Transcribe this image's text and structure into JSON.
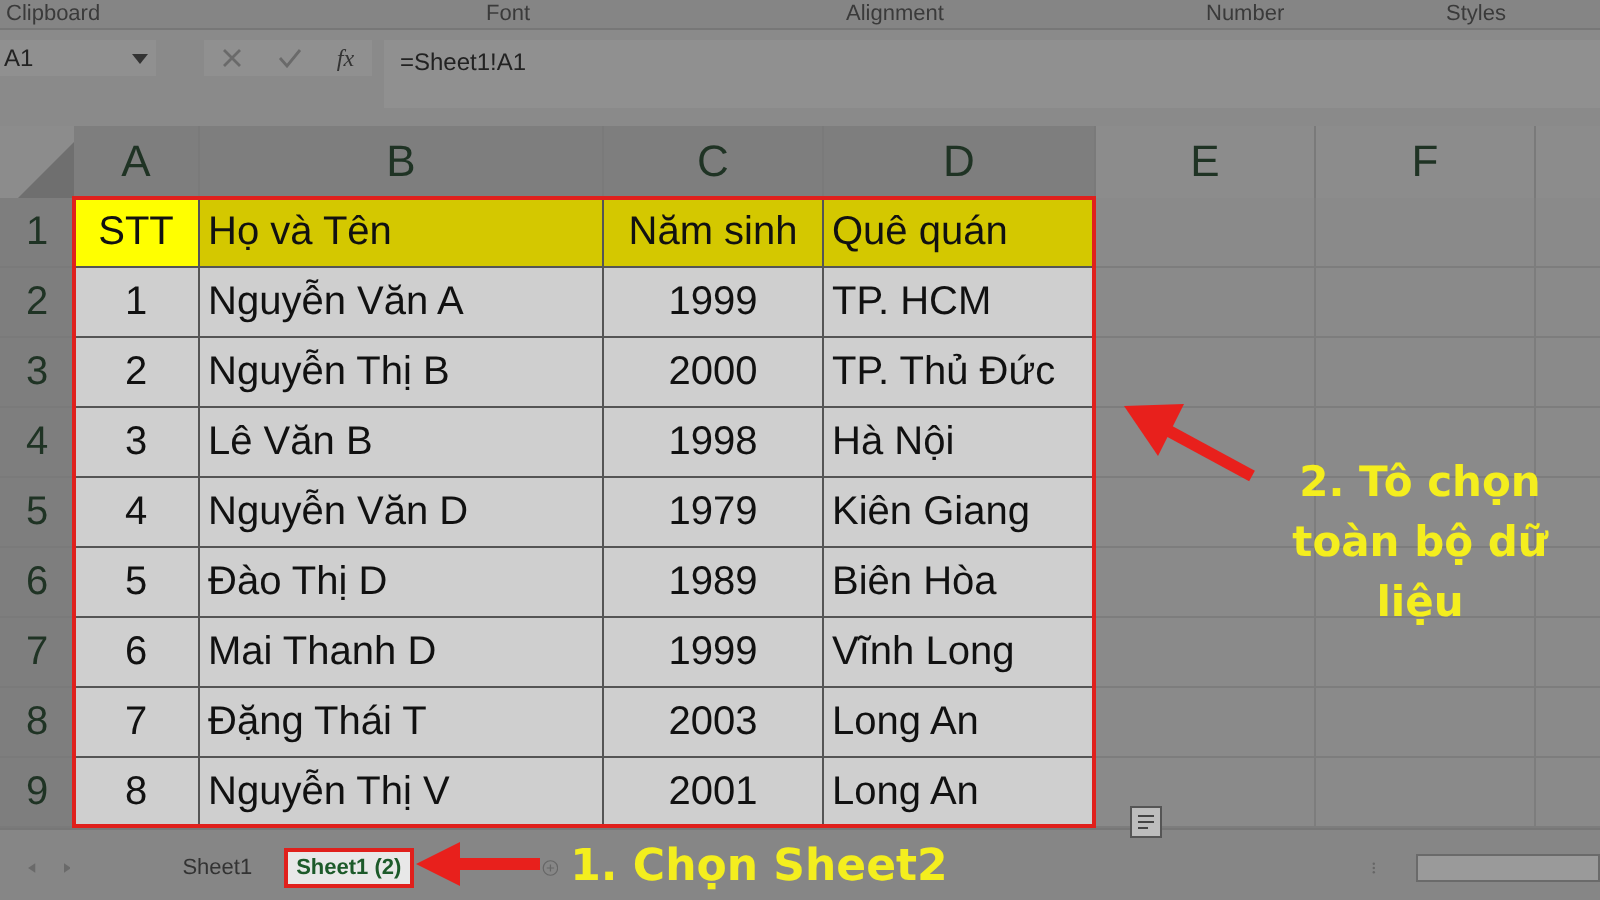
{
  "ribbon_groups": [
    "Clipboard",
    "Font",
    "Alignment",
    "Number",
    "Styles"
  ],
  "formula_bar": {
    "name_box": "A1",
    "fx": "fx",
    "formula": "=Sheet1!A1"
  },
  "columns": [
    "A",
    "B",
    "C",
    "D",
    "E",
    "F"
  ],
  "header_row": {
    "number": "1",
    "cells": [
      {
        "text": "STT",
        "color": "#ffff00"
      },
      {
        "text": "Họ và Tên",
        "color": "#d4c800"
      },
      {
        "text": "Năm sinh",
        "color": "#d4c800"
      },
      {
        "text": "Quê quán",
        "color": "#d4c800"
      }
    ]
  },
  "rows": [
    {
      "number": "2",
      "selected": true,
      "cells": [
        "1",
        "Nguyễn Văn A",
        "1999",
        "TP. HCM"
      ]
    },
    {
      "number": "3",
      "selected": true,
      "cells": [
        "2",
        "Nguyễn Thị B",
        "2000",
        "TP. Thủ Đức"
      ]
    },
    {
      "number": "4",
      "selected": true,
      "cells": [
        "3",
        "Lê Văn B",
        "1998",
        "Hà Nội"
      ]
    },
    {
      "number": "5",
      "selected": true,
      "cells": [
        "4",
        "Nguyễn Văn D",
        "1979",
        "Kiên Giang"
      ]
    },
    {
      "number": "6",
      "selected": true,
      "cells": [
        "5",
        "Đào Thị D",
        "1989",
        "Biên Hòa"
      ]
    },
    {
      "number": "7",
      "selected": true,
      "cells": [
        "6",
        "Mai Thanh D",
        "1999",
        "Vĩnh Long"
      ]
    },
    {
      "number": "8",
      "selected": true,
      "cells": [
        "7",
        "Đặng Thái T",
        "2003",
        "Long An"
      ]
    },
    {
      "number": "9",
      "selected": true,
      "cells": [
        "8",
        "Nguyễn Thị V",
        "2001",
        "Long An"
      ]
    }
  ],
  "sheet_tabs": [
    {
      "label": "Sheet1",
      "selected": false
    },
    {
      "label": "Sheet1 (2)",
      "selected": true
    }
  ],
  "annotations": {
    "step_1": "1. Chọn Sheet2",
    "step_2": [
      "2. Tô chọn",
      "toàn bộ dữ",
      "liệu"
    ]
  }
}
